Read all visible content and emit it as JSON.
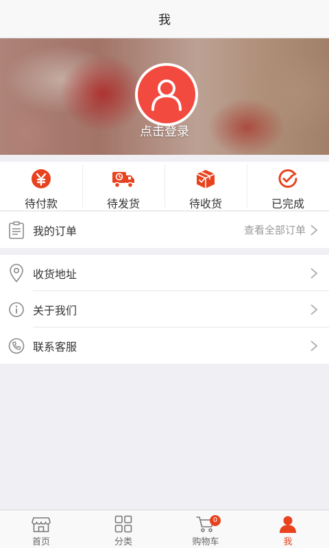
{
  "header": {
    "title": "我"
  },
  "profile": {
    "login_text": "点击登录"
  },
  "order_status": [
    {
      "label": "待付款",
      "icon": "yen-circle-icon"
    },
    {
      "label": "待发货",
      "icon": "delivery-truck-icon"
    },
    {
      "label": "待收货",
      "icon": "package-box-icon"
    },
    {
      "label": "已完成",
      "icon": "completed-check-icon"
    }
  ],
  "orders": {
    "label": "我的订单",
    "link": "查看全部订单"
  },
  "menu": [
    {
      "label": "收货地址",
      "icon": "location-pin-icon"
    },
    {
      "label": "关于我们",
      "icon": "info-icon"
    },
    {
      "label": "联系客服",
      "icon": "phone-icon"
    }
  ],
  "tabbar": {
    "tabs": [
      {
        "label": "首页",
        "icon": "store-icon"
      },
      {
        "label": "分类",
        "icon": "grid-icon"
      },
      {
        "label": "购物车",
        "icon": "cart-icon"
      },
      {
        "label": "我",
        "icon": "user-icon"
      }
    ],
    "cart_badge": "0",
    "active_tab": "我"
  },
  "colors": {
    "accent": "#e8421e",
    "avatar_bg": "#f24a3f",
    "page_bg": "#efeff4"
  }
}
